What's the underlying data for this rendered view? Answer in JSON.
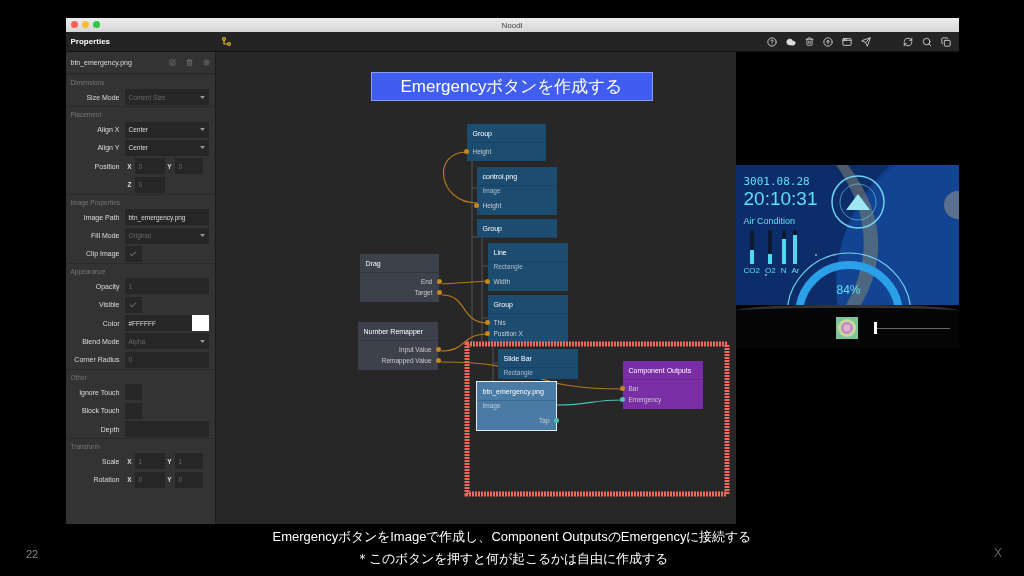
{
  "window": {
    "title": "Noodl"
  },
  "panel": {
    "title": "Properties",
    "file": "btn_emergency.png",
    "sections": [
      {
        "title": "Dimensions",
        "rows": [
          {
            "label": "Size Mode",
            "kind": "select",
            "placeholder": "Content Size"
          }
        ]
      },
      {
        "title": "Placement",
        "rows": [
          {
            "label": "Align X",
            "kind": "select",
            "value": "Center"
          },
          {
            "label": "Align Y",
            "kind": "select",
            "value": "Center"
          },
          {
            "label": "Position",
            "kind": "axes",
            "axes": [
              {
                "axis": "X",
                "placeholder": "0"
              },
              {
                "axis": "Y",
                "placeholder": "0"
              }
            ]
          },
          {
            "kind": "axes",
            "axes": [
              {
                "axis": "Z",
                "placeholder": "0"
              }
            ]
          }
        ]
      },
      {
        "title": "Image Properties",
        "rows": [
          {
            "label": "Image Path",
            "kind": "text",
            "value": "btn_emergency.png"
          },
          {
            "label": "Fill Mode",
            "kind": "select",
            "placeholder": "Original"
          },
          {
            "label": "Clip Image",
            "kind": "check",
            "checked": true
          }
        ]
      },
      {
        "title": "Appearance",
        "rows": [
          {
            "label": "Opacity",
            "kind": "text",
            "placeholder": "1"
          },
          {
            "label": "Visible",
            "kind": "check",
            "checked": true
          },
          {
            "label": "Color",
            "kind": "color",
            "value": "#FFFFFF"
          },
          {
            "label": "Blend Mode",
            "kind": "select",
            "placeholder": "Alpha"
          },
          {
            "label": "Corner Radius",
            "kind": "text",
            "placeholder": "0"
          }
        ]
      },
      {
        "title": "Other",
        "rows": [
          {
            "label": "Ignore Touch",
            "kind": "check",
            "checked": false
          },
          {
            "label": "Block Touch",
            "kind": "check",
            "checked": false
          },
          {
            "label": "Depth",
            "kind": "text"
          }
        ]
      },
      {
        "title": "Transform",
        "rows": [
          {
            "label": "Scale",
            "kind": "axes",
            "axes": [
              {
                "axis": "X",
                "placeholder": "1"
              },
              {
                "axis": "Y",
                "placeholder": "1"
              }
            ]
          },
          {
            "label": "Rotation",
            "kind": "axes",
            "axes": [
              {
                "axis": "X",
                "placeholder": "0"
              },
              {
                "axis": "Y",
                "placeholder": "0"
              }
            ]
          }
        ]
      }
    ]
  },
  "canvas": {
    "banner": "Emergencyボタンを作成する",
    "nodes": [
      {
        "title": "Group",
        "kind": "visual",
        "selected": false,
        "inputs": [
          {
            "label": "Height",
            "kind": "value"
          }
        ]
      },
      {
        "title": "control.png",
        "subtitle": "Image",
        "kind": "visual",
        "selected": false,
        "inputs": [
          {
            "label": "Height",
            "kind": "value"
          }
        ]
      },
      {
        "title": "Group",
        "kind": "visual",
        "selected": false
      },
      {
        "title": "Line",
        "subtitle": "Rectangle",
        "kind": "visual",
        "selected": false,
        "inputs": [
          {
            "label": "Width",
            "kind": "value"
          }
        ]
      },
      {
        "title": "Group",
        "kind": "visual",
        "selected": false,
        "inputs": [
          {
            "label": "This",
            "kind": "value"
          },
          {
            "label": "Position X",
            "kind": "value"
          }
        ]
      },
      {
        "title": "Drag",
        "kind": "logic",
        "selected": false,
        "outputs": [
          {
            "label": "End",
            "kind": "value"
          },
          {
            "label": "Target",
            "kind": "value"
          }
        ]
      },
      {
        "title": "Number Remapper",
        "kind": "logic",
        "selected": false,
        "outputs": [
          {
            "label": "Input Value",
            "kind": "value"
          },
          {
            "label": "Remapped Value",
            "kind": "value"
          }
        ]
      },
      {
        "title": "Slide Bar",
        "subtitle": "Rectangle",
        "kind": "visual",
        "selected": false
      },
      {
        "title": "btn_emergency.png",
        "subtitle": "Image",
        "kind": "visual",
        "selected": true,
        "outputs": [
          {
            "label": "Tap",
            "kind": "signal"
          }
        ]
      },
      {
        "title": "Component Outputs",
        "kind": "output",
        "selected": false,
        "inputs": [
          {
            "label": "Bar",
            "kind": "value"
          },
          {
            "label": "Emergency",
            "kind": "signal"
          }
        ]
      }
    ]
  },
  "preview": {
    "date": "3001.08.28",
    "time": "20:10:31",
    "air_title": "Air Condition",
    "gases": [
      {
        "label": "CO2",
        "level": 0.4
      },
      {
        "label": "O2",
        "level": 0.3
      },
      {
        "label": "N",
        "level": 0.75
      },
      {
        "label": "Ar",
        "level": 0.85
      }
    ],
    "gauge": "84%",
    "slider": {
      "level": 0.0
    }
  },
  "captions": [
    "EmergencyボタンをImageで作成し、Component OutputsのEmergencyに接続する",
    "＊このボタンを押すと何が起こるかは自由に作成する"
  ],
  "page_number": "22",
  "corner_mark": "X"
}
